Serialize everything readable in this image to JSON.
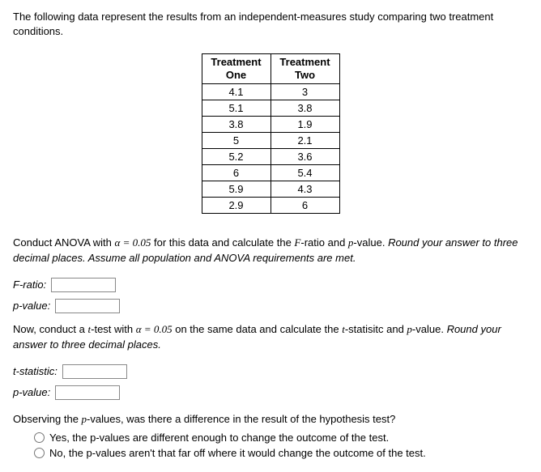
{
  "intro": "The following data represent the results from an independent-measures study comparing two treatment conditions.",
  "table": {
    "headers": {
      "col1_line1": "Treatment",
      "col1_line2": "One",
      "col2_line1": "Treatment",
      "col2_line2": "Two"
    },
    "rows": [
      {
        "c1": "4.1",
        "c2": "3"
      },
      {
        "c1": "5.1",
        "c2": "3.8"
      },
      {
        "c1": "3.8",
        "c2": "1.9"
      },
      {
        "c1": "5",
        "c2": "2.1"
      },
      {
        "c1": "5.2",
        "c2": "3.6"
      },
      {
        "c1": "6",
        "c2": "5.4"
      },
      {
        "c1": "5.9",
        "c2": "4.3"
      },
      {
        "c1": "2.9",
        "c2": "6"
      }
    ]
  },
  "anova_instr": {
    "part1": "Conduct ANOVA with ",
    "alpha_eq": "α = 0.05",
    "part2": " for this data and calculate the ",
    "fr": "F",
    "part3": "-ratio and ",
    "pv": "p",
    "part4": "-value. ",
    "ital_hint": "Round your answer to three decimal places. Assume all population and ANOVA requirements are met."
  },
  "labels": {
    "f_ratio": "F-ratio:",
    "p_value": "p-value:",
    "t_stat": "t-statistic:"
  },
  "ttest_instr": {
    "part1": "Now, conduct a ",
    "tv": "t",
    "part2": "-test with ",
    "alpha_eq": "α = 0.05",
    "part3": " on the same data and calculate the ",
    "tv2": "t",
    "part4": "-statisitc and ",
    "pv": "p",
    "part5": "-value. ",
    "ital_hint": "Round your answer to three decimal places."
  },
  "question": {
    "text_part1": "Observing the ",
    "pv": "p",
    "text_part2": "-values, was there a difference in the result of the hypothesis test?",
    "opt1": "Yes, the p-values are different enough to change the outcome of the test.",
    "opt2": "No, the p-values aren't that far off where it would change the outcome of the test."
  }
}
